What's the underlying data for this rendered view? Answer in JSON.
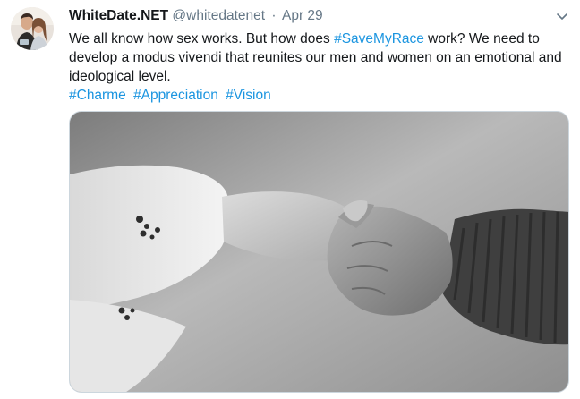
{
  "tweet": {
    "author_name": "WhiteDate.NET",
    "author_handle": "@whitedatenet",
    "separator": "·",
    "date": "Apr 29",
    "text_part1": "We all know how sex works. But how does ",
    "text_hashtag": "#SaveMyRace",
    "text_part2": " work? We need to develop a modus vivendi that reunites our men and women on an emotional and ideological level.",
    "hashtags": [
      "#Charme",
      "#Appreciation",
      "#Vision"
    ],
    "icons": {
      "avatar": "profile-photo-couple",
      "caret": "chevron-down-icon",
      "media": "black-and-white-photo-holding-hands"
    },
    "colors": {
      "link": "#1b95e0",
      "secondary_text": "#657786",
      "primary_text": "#14171a"
    }
  }
}
